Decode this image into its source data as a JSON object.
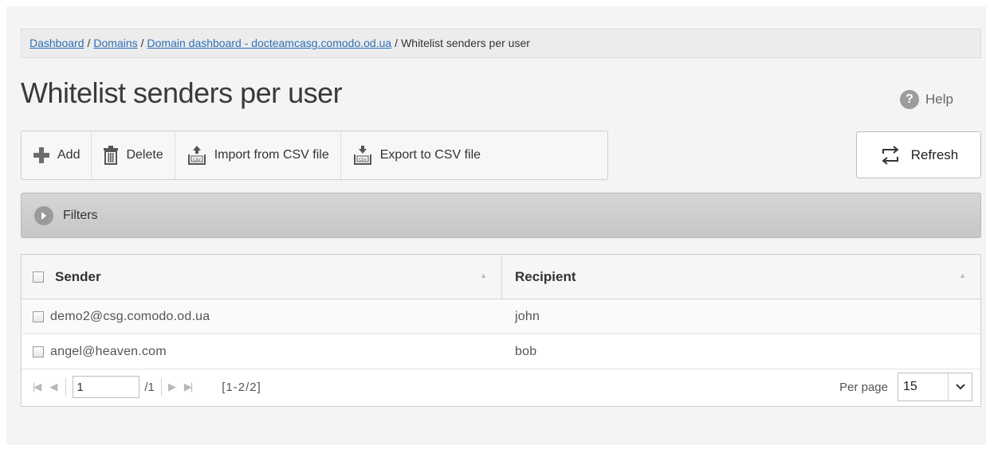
{
  "breadcrumb": {
    "items": [
      "Dashboard",
      "Domains",
      "Domain dashboard - docteamcasg.comodo.od.ua"
    ],
    "current": "Whitelist senders per user",
    "separator": "/"
  },
  "page": {
    "title": "Whitelist senders per user",
    "help_label": "Help",
    "help_icon_glyph": "?"
  },
  "toolbar": {
    "add_label": "Add",
    "delete_label": "Delete",
    "import_label": "Import from CSV file",
    "export_label": "Export to CSV file",
    "refresh_label": "Refresh"
  },
  "filters": {
    "label": "Filters"
  },
  "table": {
    "columns": [
      "Sender",
      "Recipient"
    ],
    "rows": [
      {
        "sender": "demo2@csg.comodo.od.ua",
        "recipient": "john"
      },
      {
        "sender": "angel@heaven.com",
        "recipient": "bob"
      }
    ]
  },
  "pager": {
    "page_value": "1",
    "total_pages": "/1",
    "range": "[1-2/2]",
    "per_page_label": "Per page",
    "per_page_value": "15"
  },
  "colors": {
    "link": "#2b6fb6",
    "add_icon": "#6c6c6c",
    "filters_bar": "#c9c9c9"
  }
}
